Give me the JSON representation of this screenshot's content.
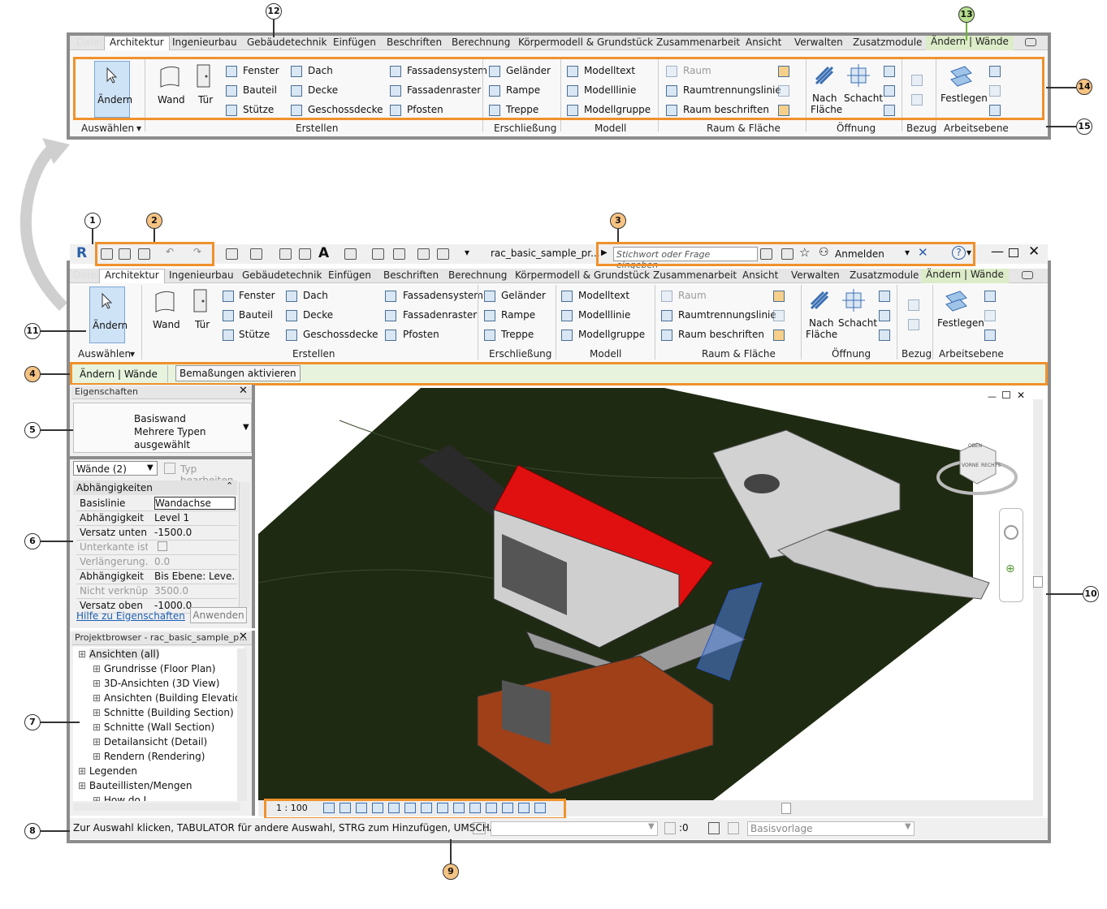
{
  "ribbon_tabs": [
    "Datei",
    "Architektur",
    "Ingenieurbau",
    "Gebäudetechnik",
    "Einfügen",
    "Beschriften",
    "Berechnung",
    "Körpermodell & Grundstück",
    "Zusammenarbeit",
    "Ansicht",
    "Verwalten",
    "Zusatzmodule",
    "Ändern | Wände"
  ],
  "ribbon": {
    "select": {
      "modify_label": "Ändern",
      "panel_title": "Auswählen"
    },
    "build": {
      "wall": "Wand",
      "door": "Tür",
      "window": "Fenster",
      "component": "Bauteil",
      "column": "Stütze",
      "roof": "Dach",
      "ceiling": "Decke",
      "floor": "Geschossdecke",
      "curtain_system": "Fassadensystem",
      "curtain_grid": "Fassadenraster",
      "mullion": "Pfosten",
      "panel_title": "Erstellen"
    },
    "circulation": {
      "railing": "Geländer",
      "ramp": "Rampe",
      "stair": "Treppe",
      "panel_title": "Erschließung"
    },
    "model": {
      "model_text": "Modelltext",
      "model_line": "Modelllinie",
      "model_group": "Modellgruppe",
      "panel_title": "Modell"
    },
    "room": {
      "room": "Raum",
      "room_separator": "Raumtrennungslinie",
      "tag_room": "Raum  beschriften",
      "panel_title": "Raum & Fläche"
    },
    "opening": {
      "by_face_1": "Nach",
      "by_face_2": "Fläche",
      "shaft": "Schacht",
      "panel_title": "Öffnung"
    },
    "datum": {
      "panel_title": "Bezug"
    },
    "workplane": {
      "set": "Festlegen",
      "panel_title": "Arbeitsebene"
    }
  },
  "titlebar": {
    "filename": "rac_basic_sample_pr...",
    "search_placeholder": "Stichwort oder Frage eingeben",
    "signin": "Anmelden"
  },
  "options_bar": {
    "context": "Ändern | Wände",
    "button": "Bemaßungen aktivieren"
  },
  "properties": {
    "title": "Eigenschaften",
    "type_line1": "Basiswand",
    "type_line2": "Mehrere Typen",
    "type_line3": "ausgewählt",
    "filter": "Wände (2)",
    "edit_type": "Typ bearbeiten",
    "group": "Abhängigkeiten",
    "rows": [
      {
        "k": "Basislinie",
        "v": "Wandachse"
      },
      {
        "k": "Abhängigkeit ...",
        "v": "Level 1"
      },
      {
        "k": "Versatz unten",
        "v": "-1500.0"
      },
      {
        "k": "Unterkante ist...",
        "v": ""
      },
      {
        "k": "Verlängerung...",
        "v": "0.0"
      },
      {
        "k": "Abhängigkeit ...",
        "v": "Bis Ebene: Leve..."
      },
      {
        "k": "Nicht verknüp...",
        "v": "3500.0"
      },
      {
        "k": "Versatz oben",
        "v": "-1000.0"
      }
    ],
    "help_link": "Hilfe zu Eigenschaften",
    "apply": "Anwenden"
  },
  "project_browser": {
    "title": "Projektbrowser - rac_basic_sample_p...",
    "items": [
      {
        "label": "Ansichten (all)",
        "level": 0
      },
      {
        "label": "Grundrisse (Floor Plan)",
        "level": 1
      },
      {
        "label": "3D-Ansichten (3D View)",
        "level": 1
      },
      {
        "label": "Ansichten (Building Elevation",
        "level": 1
      },
      {
        "label": "Schnitte (Building Section)",
        "level": 1
      },
      {
        "label": "Schnitte (Wall Section)",
        "level": 1
      },
      {
        "label": "Detailansicht (Detail)",
        "level": 1
      },
      {
        "label": "Rendern (Rendering)",
        "level": 1
      },
      {
        "label": "Legenden",
        "level": 0
      },
      {
        "label": "Bauteillisten/Mengen",
        "level": 0
      },
      {
        "label": "How do I",
        "level": 1
      }
    ]
  },
  "view": {
    "scale": "1 : 100",
    "viewcube_top": "OBEN",
    "viewcube_front": "VORNE",
    "viewcube_right": "RECHTS"
  },
  "status": {
    "message": "Zur Auswahl klicken, TABULATOR für andere Auswahl, STRG zum Hinzufügen, UMSCHALT :",
    "count": ":0",
    "workset": "Basisvorlage"
  },
  "callouts": [
    "1",
    "2",
    "3",
    "4",
    "5",
    "6",
    "7",
    "8",
    "9",
    "10",
    "11",
    "12",
    "13",
    "14",
    "15"
  ],
  "colors": {
    "highlight": "#f0912c",
    "context_tab": "#dcecc8",
    "roof": "#e01010",
    "terrain": "#1f2a12",
    "selection": "#4a7fe0"
  }
}
